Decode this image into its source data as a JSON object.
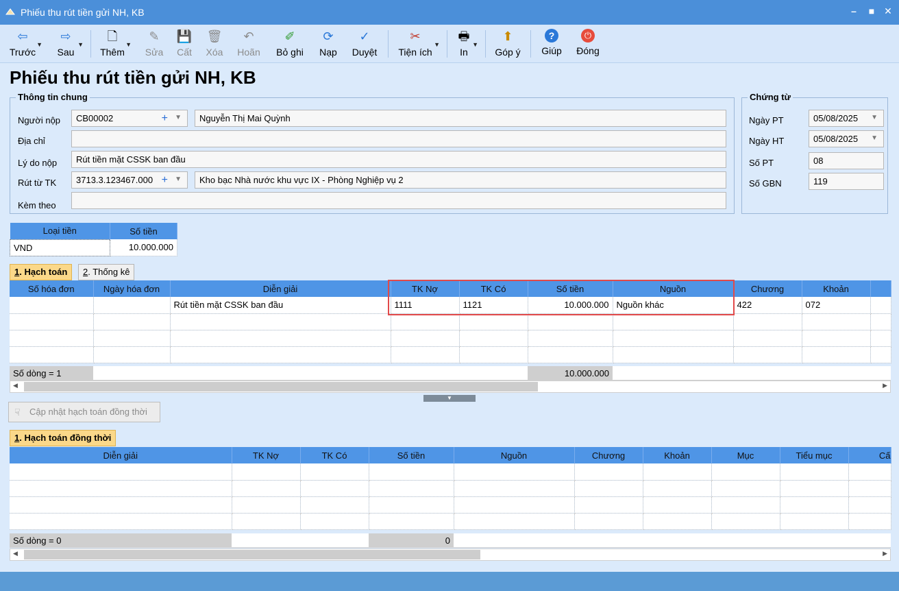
{
  "window": {
    "title": "Phiếu thu rút tiền gửi NH, KB",
    "minimize": "–",
    "maximize": "■",
    "close": "✕"
  },
  "toolbar": {
    "items": [
      {
        "label": "Trước",
        "icon": "⇦"
      },
      {
        "label": "Sau",
        "icon": "⇨"
      },
      {
        "label": "Thêm",
        "icon": "🗋"
      },
      {
        "label": "Sửa",
        "icon": "✎"
      },
      {
        "label": "Cất",
        "icon": "💾"
      },
      {
        "label": "Xóa",
        "icon": "🗑"
      },
      {
        "label": "Hoãn",
        "icon": "↶"
      },
      {
        "label": "Bỏ ghi",
        "icon": "✐"
      },
      {
        "label": "Nạp",
        "icon": "⟳"
      },
      {
        "label": "Duyệt",
        "icon": "✓"
      },
      {
        "label": "Tiện ích",
        "icon": "✂"
      },
      {
        "label": "In",
        "icon": "🖶"
      },
      {
        "label": "Góp ý",
        "icon": "⬆"
      },
      {
        "label": "Giúp",
        "icon": "?"
      },
      {
        "label": "Đóng",
        "icon": "⏻"
      }
    ]
  },
  "page_title": "Phiếu thu rút tiền gửi NH, KB",
  "general": {
    "legend": "Thông tin chung",
    "payer_label": "Người nộp",
    "payer_code": "CB00002",
    "payer_name": "Nguyễn Thị Mai Quỳnh",
    "address_label": "Địa chỉ",
    "address": "",
    "reason_label": "Lý do nộp",
    "reason": "Rút tiền mặt CSSK ban đầu",
    "account_label": "Rút từ TK",
    "account_code": "3713.3.123467.000",
    "account_name": "Kho bạc Nhà nước khu vực IX - Phòng Nghiệp vụ 2",
    "attach_label": "Kèm theo",
    "attach": ""
  },
  "voucher": {
    "legend": "Chứng từ",
    "date_pt_label": "Ngày PT",
    "date_pt": "05/08/2025",
    "date_ht_label": "Ngày HT",
    "date_ht": "05/08/2025",
    "so_pt_label": "Số PT",
    "so_pt": "08",
    "so_gbn_label": "Số GBN",
    "so_gbn": "119"
  },
  "currency_table": {
    "headers": [
      "Loại tiền",
      "Số tiền"
    ],
    "row": [
      "VND",
      "10.000.000"
    ]
  },
  "tabs": [
    {
      "num": "1",
      "label": ". Hạch toán"
    },
    {
      "num": "2",
      "label": ". Thống kê"
    }
  ],
  "entries": {
    "headers": [
      "Số hóa đơn",
      "Ngày hóa đơn",
      "Diễn giải",
      "TK Nợ",
      "TK Có",
      "Số tiền",
      "Nguồn",
      "Chương",
      "Khoản"
    ],
    "rows": [
      [
        "",
        "",
        "Rút tiền mặt CSSK ban đầu",
        "1111",
        "1121",
        "10.000.000",
        "Nguồn khác",
        "422",
        "072"
      ]
    ],
    "row_count": "Số dòng = 1",
    "total": "10.000.000"
  },
  "update_button": "Cập nhật hạch toán đồng thời",
  "concurrent_tab": {
    "num": "1",
    "label": ". Hạch toán đồng thời"
  },
  "concurrent": {
    "headers": [
      "Diễn giải",
      "TK Nợ",
      "TK Có",
      "Số tiền",
      "Nguồn",
      "Chương",
      "Khoản",
      "Mục",
      "Tiểu mục",
      "Cấ"
    ],
    "row_count": "Số dòng = 0",
    "total": "0"
  }
}
